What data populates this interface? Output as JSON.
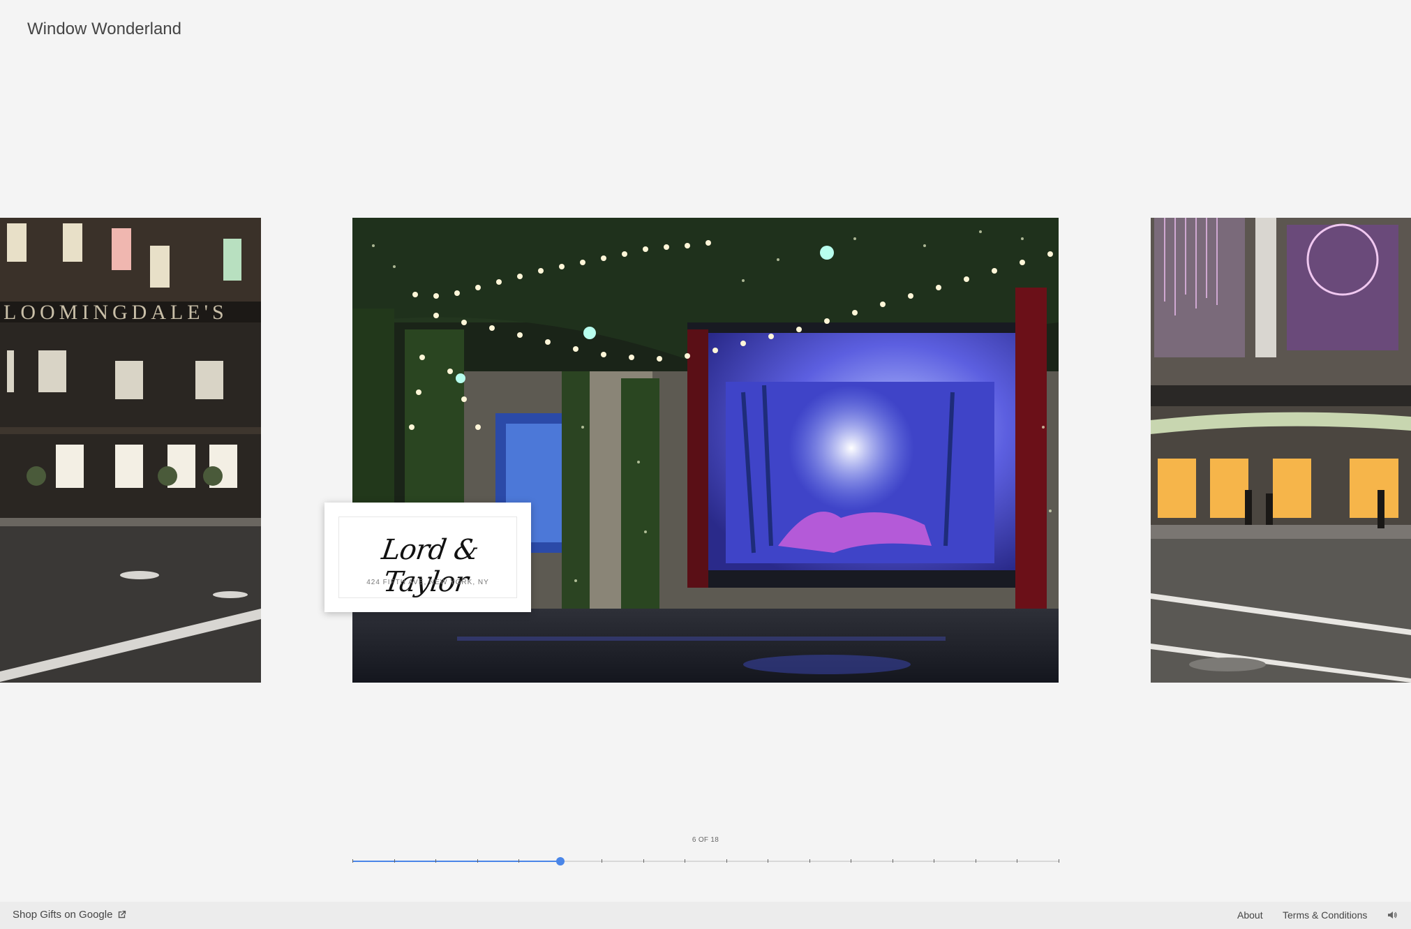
{
  "site": {
    "title": "Window Wonderland"
  },
  "current_store": {
    "logo_text": "Lord & Taylor",
    "address": "424 FIFTH AVE, NEW YORK, NY"
  },
  "timeline": {
    "counter_text": "6 OF 18",
    "current": 6,
    "total": 18
  },
  "footer": {
    "shop_link": "Shop Gifts on Google",
    "about": "About",
    "terms": "Terms & Conditions"
  },
  "colors": {
    "accent": "#4a86e8",
    "background": "#f4f4f4",
    "footer_bg": "#ececec"
  },
  "icons": {
    "external_link": "external-link-icon",
    "sound": "speaker-icon"
  }
}
